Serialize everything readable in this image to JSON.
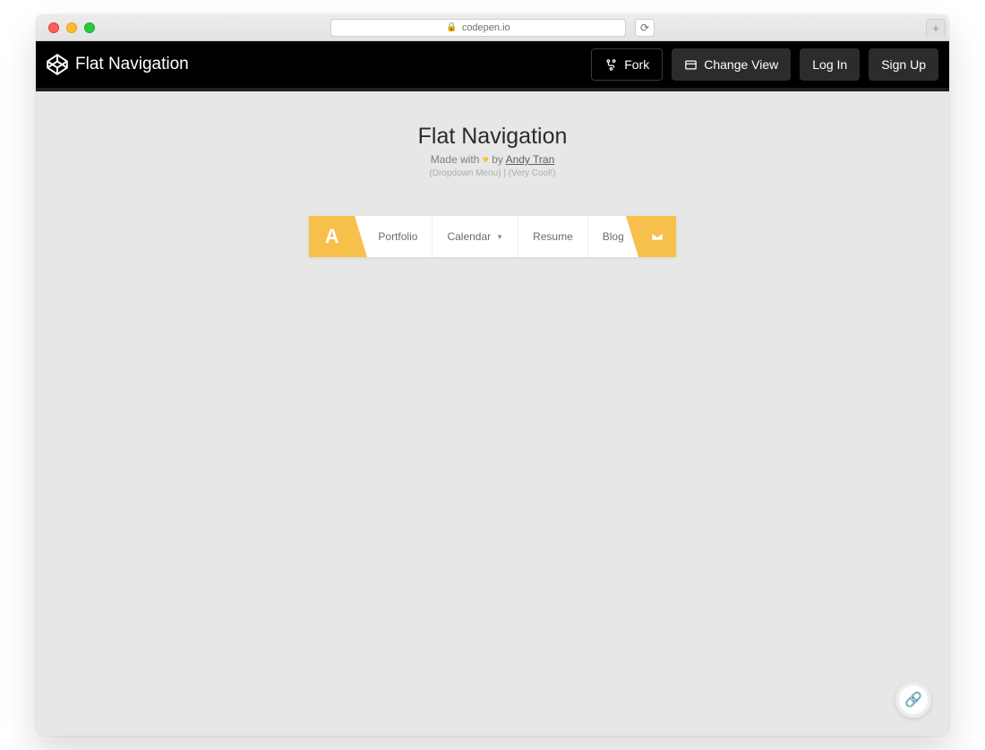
{
  "browser": {
    "url": "codepen.io"
  },
  "header": {
    "pen_title": "Flat Navigation",
    "buttons": {
      "fork": "Fork",
      "change_view": "Change View",
      "login": "Log In",
      "signup": "Sign Up"
    }
  },
  "hero": {
    "title": "Flat Navigation",
    "made_with_prefix": "Made with ",
    "made_with_suffix": " by ",
    "author": "Andy Tran",
    "meta": "(Dropdown Menu) | (Very Cool!)"
  },
  "nav": {
    "brand_letter": "A",
    "items": [
      "Portfolio",
      "Calendar",
      "Resume",
      "Blog"
    ]
  }
}
